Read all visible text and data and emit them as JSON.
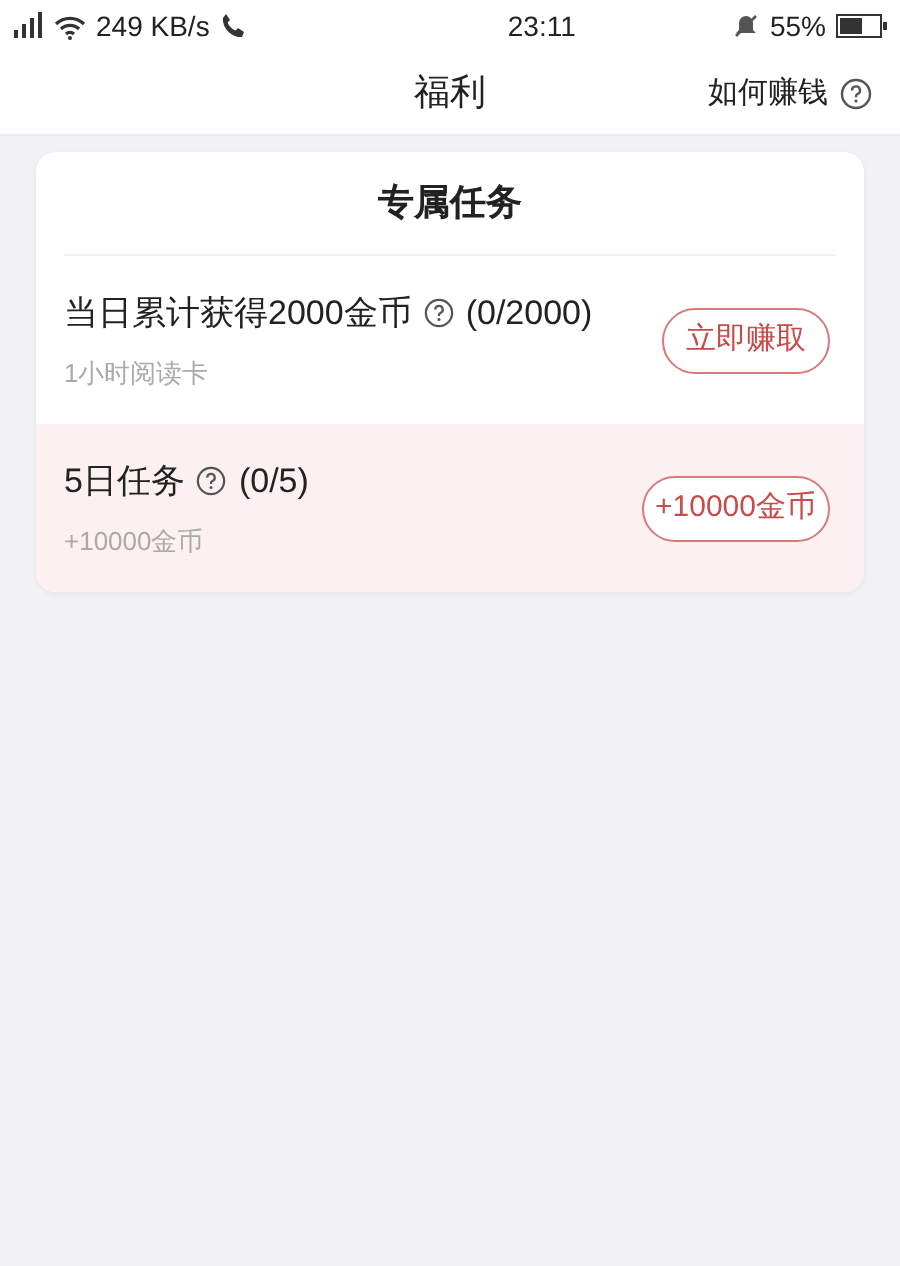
{
  "status_bar": {
    "speed": "249 KB/s",
    "time": "23:11",
    "battery": "55%"
  },
  "header": {
    "title": "福利",
    "help_link": "如何赚钱"
  },
  "card": {
    "title": "专属任务",
    "tasks": [
      {
        "title": "当日累计获得2000金币",
        "progress": "(0/2000)",
        "subtitle": "1小时阅读卡",
        "button": "立即赚取",
        "highlighted": false
      },
      {
        "title": "5日任务",
        "progress": "(0/5)",
        "subtitle": "+10000金币",
        "button": "+10000金币",
        "highlighted": true
      }
    ]
  }
}
